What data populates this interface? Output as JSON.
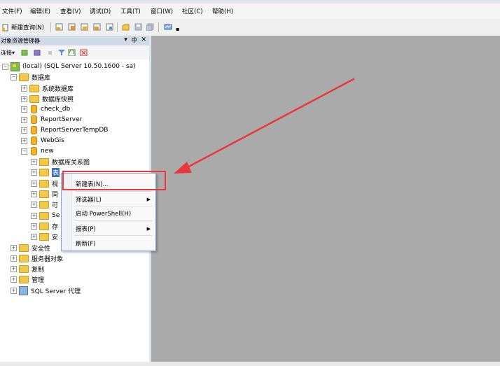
{
  "menubar": {
    "items": [
      {
        "label": "文件(F)"
      },
      {
        "label": "编辑(E)"
      },
      {
        "label": "查看(V)"
      },
      {
        "label": "调试(D)"
      },
      {
        "label": "工具(T)"
      },
      {
        "label": "窗口(W)"
      },
      {
        "label": "社区(C)"
      },
      {
        "label": "帮助(H)"
      }
    ]
  },
  "toolbar": {
    "new_query_label": "新建查询(N)",
    "icons": [
      "new-query-icon",
      "db-engine-query-icon",
      "analysis-query-icon",
      "mdx-query-icon",
      "dmx-query-icon",
      "xmla-query-icon",
      "open-file-icon",
      "save-icon",
      "save-all-icon",
      "activity-monitor-icon"
    ]
  },
  "object_explorer": {
    "title": "对象资源管理器",
    "controls": {
      "dropdown": "▾",
      "pin": "ф",
      "close": "✕"
    },
    "toolbar": {
      "connect_label": "连接▾",
      "icons": [
        "connect-object-icon",
        "disconnect-icon",
        "stop-icon",
        "filter-icon",
        "refresh-icon",
        "summary-icon"
      ]
    },
    "tree": {
      "server": "(local) (SQL Server 10.50.1600 - sa)",
      "databases_folder": "数据库",
      "system_databases": "系统数据库",
      "database_snapshots": "数据库快照",
      "databases": [
        "check_db",
        "ReportServer",
        "ReportServerTempDB",
        "WebGis"
      ],
      "new_db": "new",
      "new_children": [
        {
          "label": "数据库关系图"
        },
        {
          "label": "表"
        },
        {
          "label": "视"
        },
        {
          "label": "同"
        },
        {
          "label": "可"
        },
        {
          "label": "Se"
        },
        {
          "label": "存"
        },
        {
          "label": "安"
        }
      ],
      "top_level": [
        "安全性",
        "服务器对象",
        "复制",
        "管理"
      ],
      "agent": "SQL Server 代理"
    }
  },
  "context_menu": {
    "items": [
      {
        "label": "新建表(N)...",
        "submenu": false
      },
      {
        "label": "筛选器(L)",
        "submenu": true
      },
      {
        "label": "启动 PowerShell(H)",
        "submenu": false
      },
      {
        "label": "报表(P)",
        "submenu": true
      },
      {
        "label": "刷新(F)",
        "submenu": false
      }
    ],
    "submenu_arrow": "▶"
  },
  "annotation": {
    "highlight_color": "#e8383d",
    "arrow_color": "#e8383d"
  }
}
